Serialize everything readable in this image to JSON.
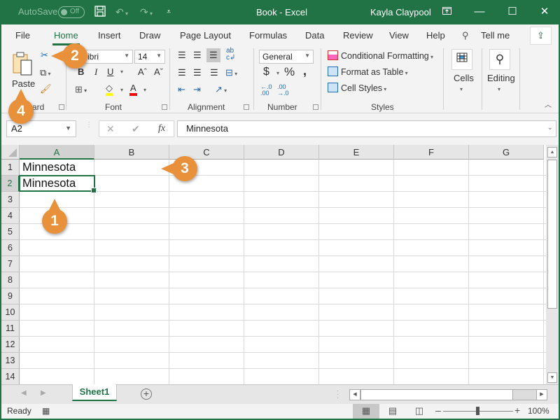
{
  "titlebar": {
    "autosave_label": "AutoSave",
    "autosave_state": "Off",
    "doc_title": "Book  -  Excel",
    "user": "Kayla Claypool",
    "icons": [
      "save-icon",
      "undo-icon",
      "redo-icon",
      "customize-qat-icon",
      "ribbon-display-icon",
      "minimize-icon",
      "maximize-icon",
      "close-icon"
    ]
  },
  "tabs": [
    "File",
    "Home",
    "Insert",
    "Draw",
    "Page Layout",
    "Formulas",
    "Data",
    "Review",
    "View",
    "Help"
  ],
  "active_tab": "Home",
  "tell_me": "Tell me",
  "ribbon": {
    "clipboard": {
      "label": "Clipboard",
      "label_visible": "ard",
      "paste": "Paste"
    },
    "font": {
      "label": "Font",
      "font_name": "Calibri",
      "font_name_visible": "bri",
      "font_size": "14",
      "bold": "B",
      "italic": "I",
      "underline": "U",
      "grow": "Aˆ",
      "shrink": "Aˇ",
      "font_color": "A",
      "fill_color_hex": "#ffff00",
      "font_color_hex": "#ff0000"
    },
    "alignment": {
      "label": "Alignment"
    },
    "number": {
      "label": "Number",
      "format": "General",
      "currency": "$",
      "percent": "%",
      "comma": "̉",
      "inc_decimal": "←.0 .00",
      "dec_decimal": ".00 →.0"
    },
    "styles": {
      "label": "Styles",
      "conditional": "Conditional Formatting",
      "format_table": "Format as Table",
      "cell_styles": "Cell Styles"
    },
    "cells": {
      "label": "Cells"
    },
    "editing": {
      "label": "Editing"
    }
  },
  "formula_bar": {
    "name_box": "A2",
    "cancel": "✕",
    "enter": "✔",
    "fx": "fx",
    "content": "Minnesota"
  },
  "grid": {
    "columns": [
      "A",
      "B",
      "C",
      "D",
      "E",
      "F",
      "G"
    ],
    "selected_column": "A",
    "rows": [
      "1",
      "2",
      "3",
      "4",
      "5",
      "6",
      "7",
      "8",
      "9",
      "10",
      "11",
      "12",
      "13",
      "14"
    ],
    "selected_row": "2",
    "cells": [
      {
        "ref": "A1",
        "value": "Minnesota"
      },
      {
        "ref": "A2",
        "value": "Minnesota"
      }
    ],
    "active_cell": "A2"
  },
  "sheets": {
    "tabs": [
      "Sheet1"
    ],
    "active": "Sheet1",
    "add": "+"
  },
  "status": {
    "ready": "Ready",
    "zoom": "100%",
    "zoom_minus": "–",
    "zoom_plus": "+"
  },
  "callouts": [
    {
      "number": "1",
      "target": "cell A2"
    },
    {
      "number": "2",
      "target": "Cut button"
    },
    {
      "number": "3",
      "target": "cell A1"
    },
    {
      "number": "4",
      "target": "Paste button"
    }
  ],
  "colors": {
    "accent": "#217346",
    "callout": "#e8913a"
  }
}
